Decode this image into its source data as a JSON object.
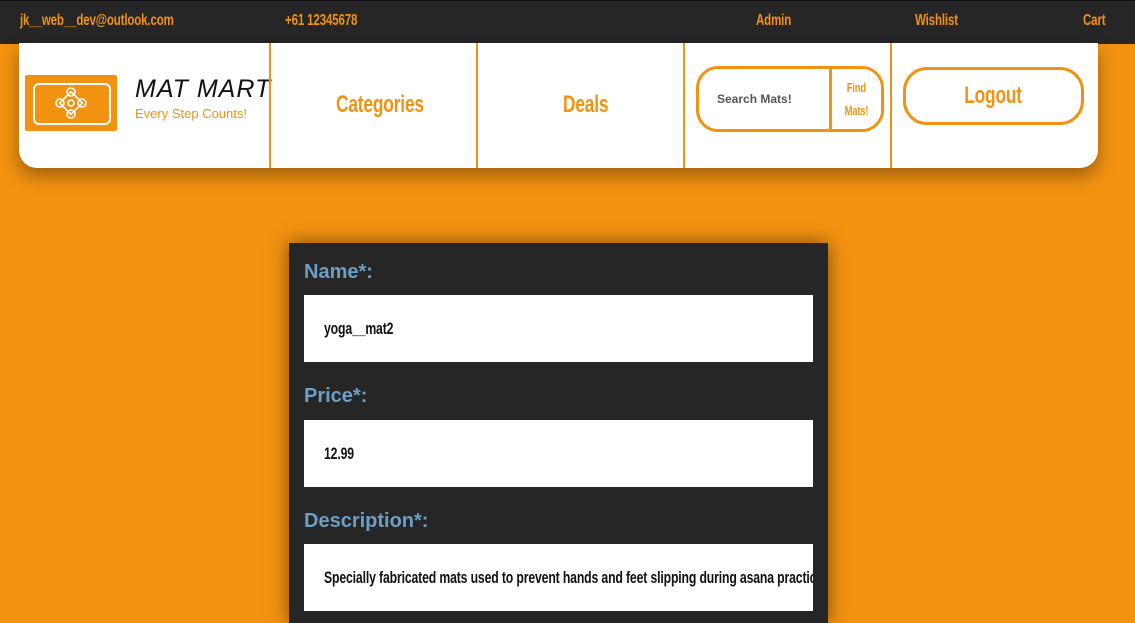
{
  "topbar": {
    "email": "jk__web__dev@outlook.com",
    "phone": "+61 12345678",
    "admin": "Admin",
    "wishlist": "Wishlist",
    "cart": "Cart"
  },
  "brand": {
    "title": "MAT MART",
    "tagline": "Every Step Counts!",
    "logo_icon": "lotus-icon"
  },
  "nav": {
    "categories": "Categories",
    "deals": "Deals",
    "search_placeholder": "Search Mats!",
    "search_button_line1": "Find",
    "search_button_line2": "Mats!",
    "logout": "Logout"
  },
  "form": {
    "name_label": "Name*:",
    "name_value": "yoga__mat2",
    "price_label": "Price*:",
    "price_value": "12.99",
    "description_label": "Description*:",
    "description_value": "Specially fabricated mats used to prevent hands and feet slipping during asana practice in modern y"
  },
  "colors": {
    "accent": "#f29211",
    "dark": "#262626",
    "label_blue": "#6d9ec4"
  }
}
